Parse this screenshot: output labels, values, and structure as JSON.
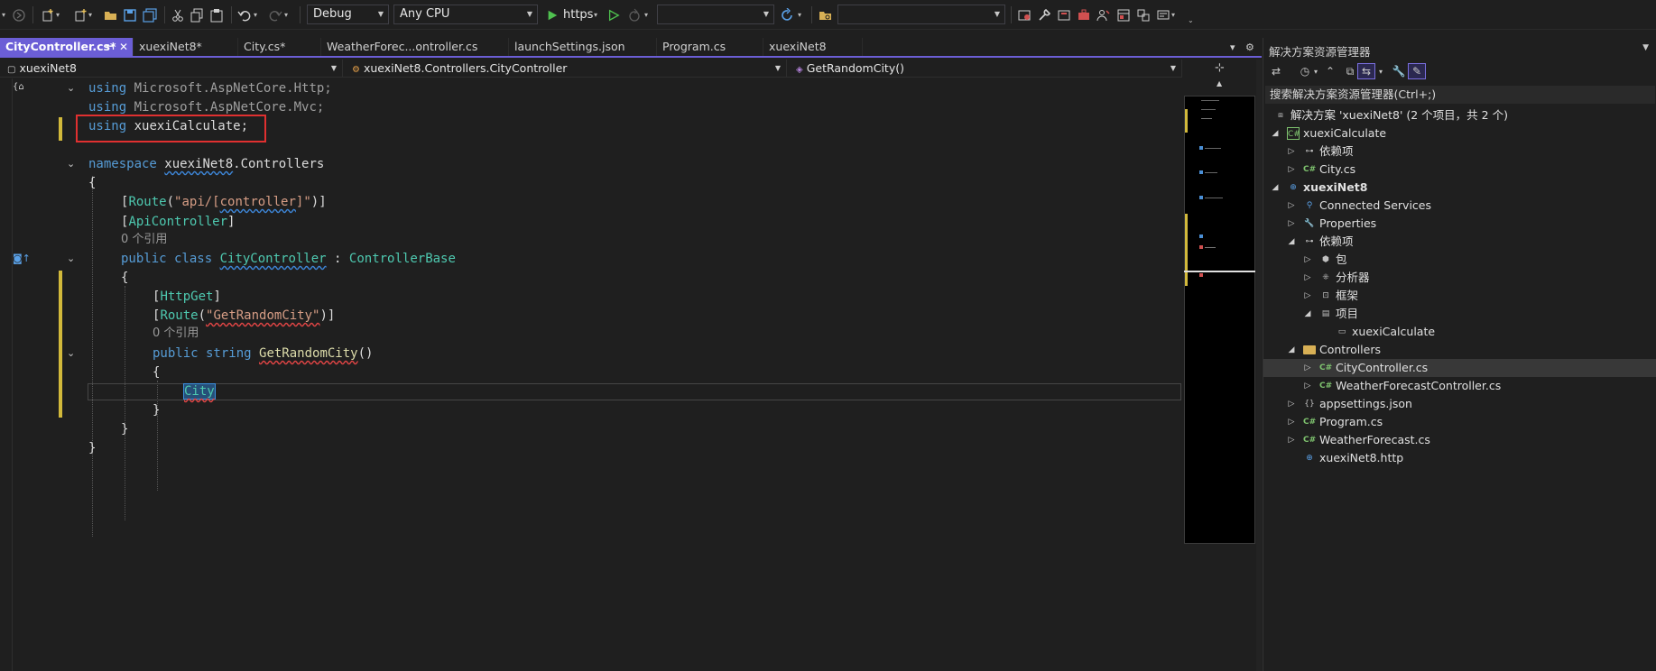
{
  "toolbar": {
    "configuration": "Debug",
    "platform": "Any CPU",
    "run_target": "https",
    "empty_combo_1": "",
    "empty_combo_2": ""
  },
  "tabs": [
    {
      "label": "CityController.cs*",
      "active": true
    },
    {
      "label": "xuexiNet8*"
    },
    {
      "label": "City.cs*"
    },
    {
      "label": "WeatherForec...ontroller.cs"
    },
    {
      "label": "launchSettings.json"
    },
    {
      "label": "Program.cs"
    },
    {
      "label": "xuexiNet8"
    }
  ],
  "navbar": {
    "project": "xuexiNet8",
    "type": "xuexiNet8.Controllers.CityController",
    "member": "GetRandomCity()"
  },
  "code": {
    "using1_kw": "using",
    "using1_ns": " Microsoft.AspNetCore.Http;",
    "using2_kw": "using",
    "using2_ns": " Microsoft.AspNetCore.Mvc;",
    "using3_kw": "using",
    "using3_ns": " xuexiCalculate;",
    "ns_kw": "namespace",
    "ns_name1": "xuexiNet8",
    "ns_name2": ".Controllers",
    "open_brace": "{",
    "attr_route_open": "[",
    "attr_route": "Route",
    "attr_route_paren": "(",
    "attr_route_str1": "\"api/[",
    "attr_route_str2": "controller",
    "attr_route_str3": "]\"",
    "attr_route_close": ")]",
    "attr_api_open": "[",
    "attr_api": "ApiController",
    "attr_api_close": "]",
    "refs": "0 个引用",
    "class_kw": "public class",
    "class_name": "CityController",
    "class_colon": " : ",
    "class_base": "ControllerBase",
    "class_open": "{",
    "attr_get_open": "[",
    "attr_get": "HttpGet",
    "attr_get_close": "]",
    "attr_r2_open": "[",
    "attr_r2": "Route",
    "attr_r2_paren": "(",
    "attr_r2_str": "\"GetRandomCity\"",
    "attr_r2_close": ")]",
    "refs2": "0 个引用",
    "method_kw": "public string",
    "method_name": "GetRandomCity",
    "method_parens": "()",
    "method_open": "{",
    "typing": "City",
    "method_close": "}",
    "class_close": "}",
    "ns_close": "}"
  },
  "solution_explorer": {
    "title": "解决方案资源管理器",
    "search": "搜索解决方案资源管理器(Ctrl+;)",
    "items": [
      {
        "label": "解决方案 'xuexiNet8' (2 个项目，共 2 个)",
        "icon": "solution-icon",
        "level": 0,
        "expander": ""
      },
      {
        "label": "xuexiCalculate",
        "icon": "csproj-icon",
        "level": 1,
        "expander": "◢"
      },
      {
        "label": "依赖项",
        "icon": "dependencies-icon",
        "level": 2,
        "expander": "▷"
      },
      {
        "label": "City.cs",
        "icon": "csharp-file-icon",
        "level": 2,
        "expander": "▷"
      },
      {
        "label": "xuexiNet8",
        "icon": "web-project-icon",
        "level": 1,
        "expander": "◢",
        "bold": true
      },
      {
        "label": "Connected Services",
        "icon": "connected-services-icon",
        "level": 2,
        "expander": "▷"
      },
      {
        "label": "Properties",
        "icon": "properties-icon",
        "level": 2,
        "expander": "▷"
      },
      {
        "label": "依赖项",
        "icon": "dependencies-icon",
        "level": 2,
        "expander": "◢"
      },
      {
        "label": "包",
        "icon": "package-icon",
        "level": 3,
        "expander": "▷"
      },
      {
        "label": "分析器",
        "icon": "analyzer-icon",
        "level": 3,
        "expander": "▷"
      },
      {
        "label": "框架",
        "icon": "framework-icon",
        "level": 3,
        "expander": "▷"
      },
      {
        "label": "项目",
        "icon": "project-ref-icon",
        "level": 3,
        "expander": "◢"
      },
      {
        "label": "xuexiCalculate",
        "icon": "project-ref-item-icon",
        "level": 4,
        "expander": ""
      },
      {
        "label": "Controllers",
        "icon": "folder-icon",
        "level": 2,
        "expander": "◢"
      },
      {
        "label": "CityController.cs",
        "icon": "csharp-file-icon",
        "level": 3,
        "expander": "▷",
        "selected": true
      },
      {
        "label": "WeatherForecastController.cs",
        "icon": "csharp-file-icon",
        "level": 3,
        "expander": "▷"
      },
      {
        "label": "appsettings.json",
        "icon": "json-file-icon",
        "level": 2,
        "expander": "▷"
      },
      {
        "label": "Program.cs",
        "icon": "csharp-file-icon",
        "level": 2,
        "expander": "▷"
      },
      {
        "label": "WeatherForecast.cs",
        "icon": "csharp-file-icon",
        "level": 2,
        "expander": "▷"
      },
      {
        "label": "xuexiNet8.http",
        "icon": "http-file-icon",
        "level": 2,
        "expander": ""
      }
    ]
  },
  "colors": {
    "accent": "#6b5ed6",
    "keyword": "#569cd6",
    "type": "#4ec9b0",
    "string": "#d69d85",
    "method": "#dcdcaa",
    "highlight_box": "#e03030"
  }
}
